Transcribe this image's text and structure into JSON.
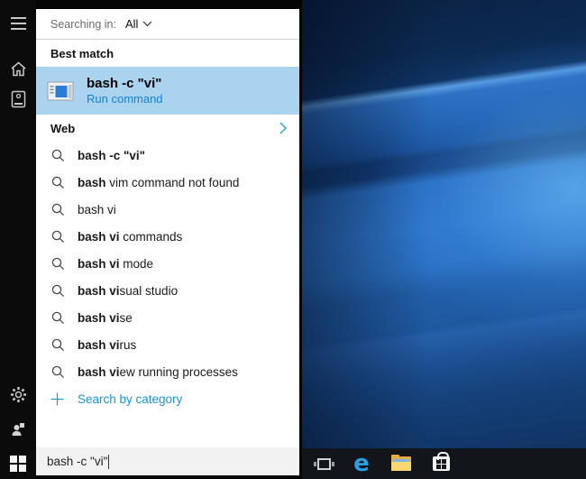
{
  "scope": {
    "label": "Searching in:",
    "value": "All"
  },
  "sections": {
    "best_match": "Best match"
  },
  "best_match": {
    "title": "bash -c \"vi\"",
    "subtitle": "Run command",
    "icon": "run-command-window-icon"
  },
  "web": {
    "label": "Web",
    "chevron_icon": "chevron-right-icon"
  },
  "suggestions": [
    {
      "segments": [
        {
          "text": "bash -c \"vi\"",
          "bold": true
        }
      ]
    },
    {
      "segments": [
        {
          "text": "bash",
          "bold": true
        },
        {
          "text": " vim command not found",
          "bold": false
        }
      ]
    },
    {
      "segments": [
        {
          "text": "bash vi",
          "bold": false
        }
      ]
    },
    {
      "segments": [
        {
          "text": "bash vi",
          "bold": true
        },
        {
          "text": " commands",
          "bold": false
        }
      ]
    },
    {
      "segments": [
        {
          "text": "bash vi",
          "bold": true
        },
        {
          "text": " mode",
          "bold": false
        }
      ]
    },
    {
      "segments": [
        {
          "text": "bash vi",
          "bold": true
        },
        {
          "text": "sual studio",
          "bold": false
        }
      ]
    },
    {
      "segments": [
        {
          "text": "bash vi",
          "bold": true
        },
        {
          "text": "se",
          "bold": false
        }
      ]
    },
    {
      "segments": [
        {
          "text": "bash vi",
          "bold": true
        },
        {
          "text": "rus",
          "bold": false
        }
      ]
    },
    {
      "segments": [
        {
          "text": "bash vi",
          "bold": true
        },
        {
          "text": "ew running processes",
          "bold": false
        }
      ]
    }
  ],
  "category_link": {
    "label": "Search by category",
    "icon": "plus-icon"
  },
  "search_box": {
    "value": "bash -c \"vi\"",
    "caret_visible": true
  },
  "sidebar": {
    "icons": [
      "menu-icon",
      "home-icon",
      "notebook-icon",
      "settings-gear-icon",
      "feedback-icon"
    ],
    "start": "windows-logo-icon"
  },
  "taskbar": {
    "icons": [
      "task-view-icon",
      "edge-browser-icon",
      "file-explorer-icon",
      "windows-store-icon"
    ]
  },
  "icons_map": {
    "search-icon": "magnifier outline",
    "chevron-down-icon": "thin v chevron",
    "chevron-right-icon": "thin > chevron, blue",
    "plus-icon": "thin + cross, blue",
    "run-command-window-icon": "gray window with blue square",
    "menu-icon": "three horizontal bars",
    "home-icon": "house outline",
    "notebook-icon": "book outline with circle",
    "settings-gear-icon": "gear outline",
    "feedback-icon": "person silhouette with square",
    "windows-logo-icon": "four white panes",
    "task-view-icon": "rectangle with side brackets",
    "edge-browser-icon": "blue lowercase e",
    "file-explorer-icon": "yellow folder",
    "windows-store-icon": "white shopping bag with window panes"
  },
  "colors": {
    "accent_blue": "#0078d7",
    "link_blue": "#1583d6",
    "category_blue": "#1a93d8",
    "best_match_highlight": "#a9d3ee",
    "panel_bg": "#ffffff",
    "input_bg": "#f2f2f2",
    "sidebar_bg": "#0b0b0c",
    "taskbar_bg": "#121519",
    "desktop_blue": "#2e77cc"
  }
}
